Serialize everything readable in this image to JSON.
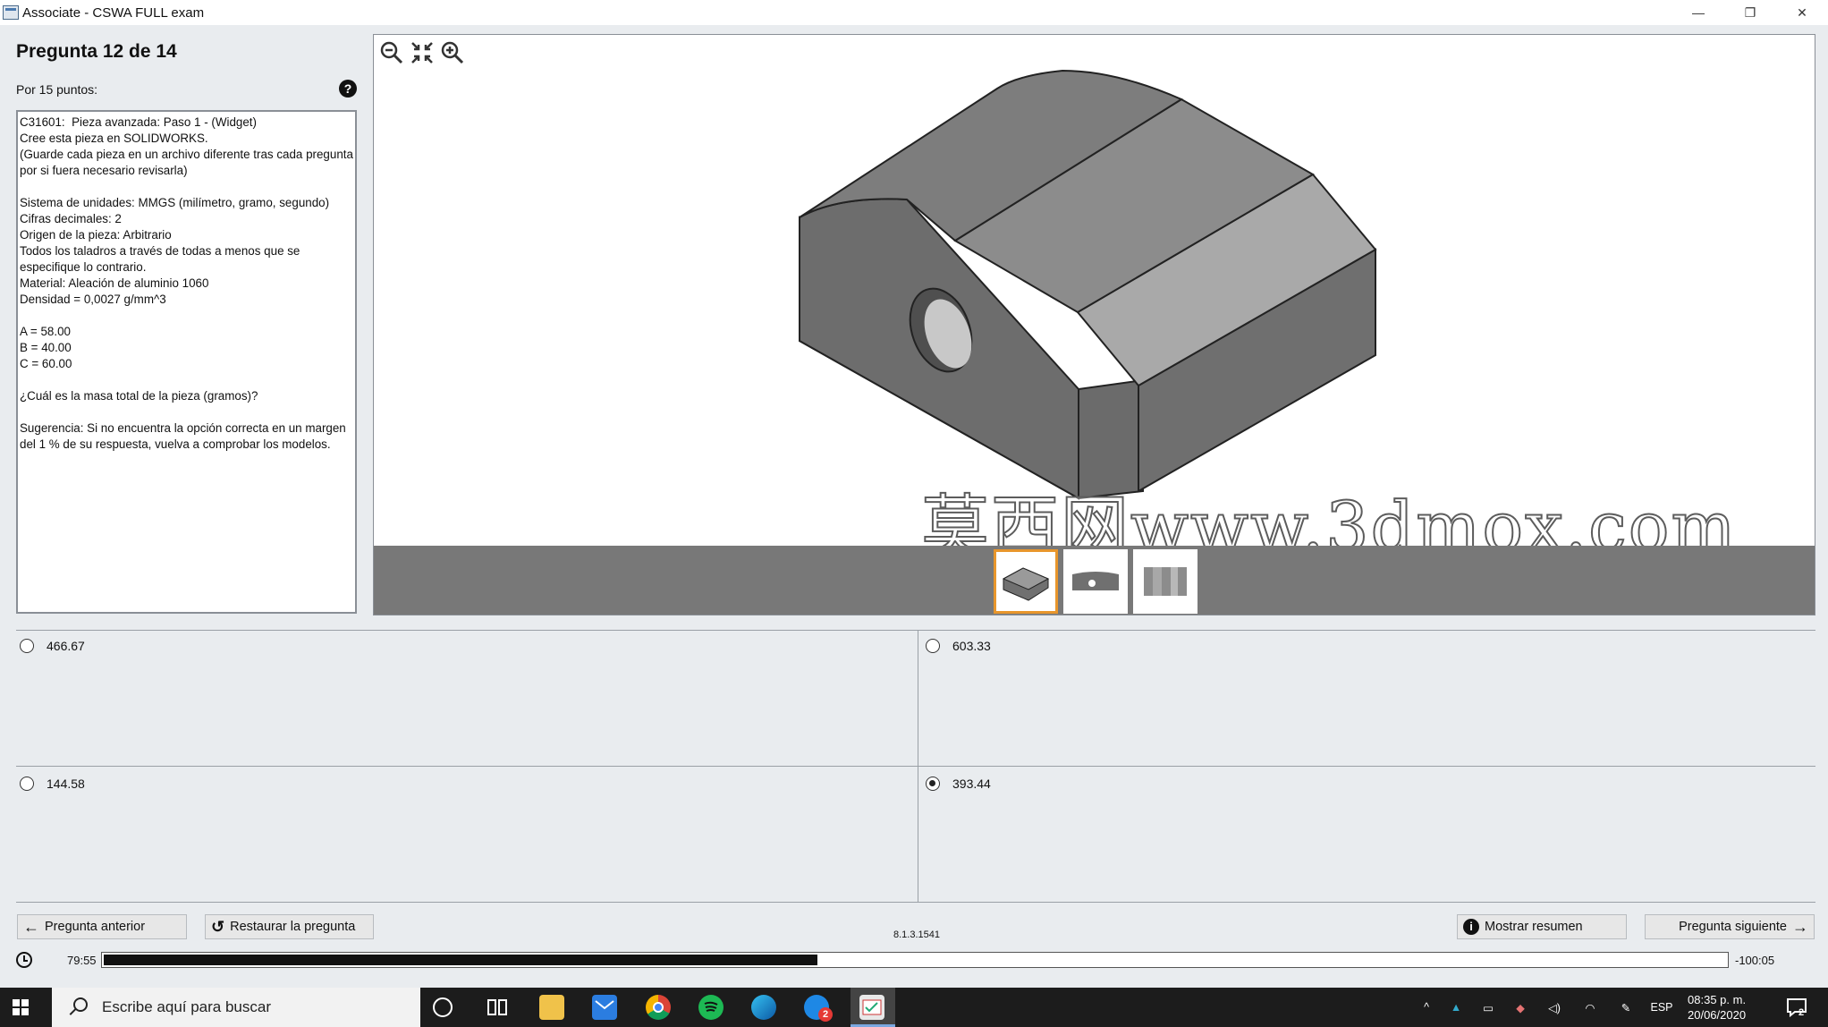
{
  "window": {
    "title": "Associate - CSWA FULL exam",
    "minimize": "—",
    "restore": "❐",
    "close": "✕"
  },
  "question": {
    "header": "Pregunta 12 de 14",
    "points": "Por 15 puntos:",
    "help_icon": "question-circle-icon",
    "text": "C31601:  Pieza avanzada: Paso 1 - (Widget)\nCree esta pieza en SOLIDWORKS.\n(Guarde cada pieza en un archivo diferente tras cada pregunta por si fuera necesario revisarla)\n\nSistema de unidades: MMGS (milímetro, gramo, segundo)\nCifras decimales: 2\nOrigen de la pieza: Arbitrario\nTodos los taladros a través de todas a menos que se especifique lo contrario.\nMaterial: Aleación de aluminio 1060\nDensidad = 0,0027 g/mm^3\n\nA = 58.00\nB = 40.00\nC = 60.00\n\n¿Cuál es la masa total de la pieza (gramos)?\n\nSugerencia: Si no encuentra la opción correcta en un margen del 1 % de su respuesta, vuelva a comprobar los modelos."
  },
  "viewer": {
    "tools": [
      "zoom-out-icon",
      "fit-view-icon",
      "zoom-in-icon"
    ],
    "watermark": "莫西网www.3dmox.com",
    "thumbnails": [
      "iso-view",
      "front-view",
      "top-view"
    ],
    "active_thumbnail": 0
  },
  "answers": [
    {
      "label": "466.67",
      "selected": false
    },
    {
      "label": "603.33",
      "selected": false
    },
    {
      "label": "144.58",
      "selected": false
    },
    {
      "label": "393.44",
      "selected": true
    }
  ],
  "nav": {
    "prev": "Pregunta anterior",
    "reset": "Restaurar la pregunta",
    "summary": "Mostrar resumen",
    "next": "Pregunta siguiente",
    "version": "8.1.3.1541"
  },
  "timer": {
    "elapsed": "79:55",
    "remaining": "-100:05",
    "progress": 0.44
  },
  "taskbar": {
    "search_placeholder": "Escribe aquí para buscar",
    "language": "ESP",
    "time": "08:35 p. m.",
    "date": "20/06/2020",
    "edge_badge": "2",
    "notification_count": "2"
  },
  "colors": {
    "accent_thumb": "#e8962c",
    "viewer_bar": "#787878"
  }
}
